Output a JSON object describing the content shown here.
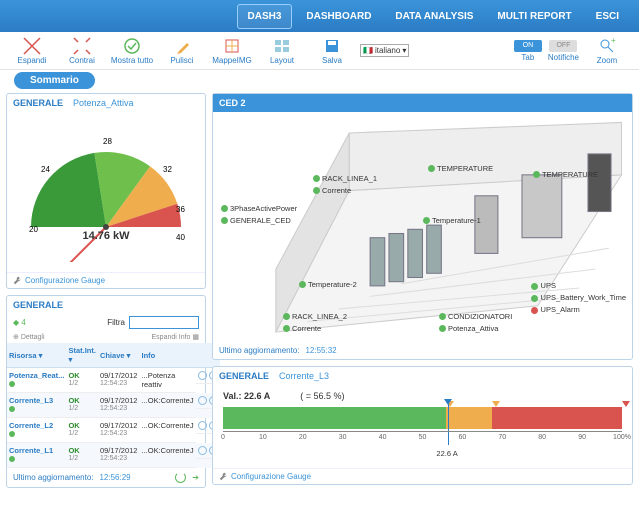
{
  "nav": {
    "items": [
      "DASH3",
      "DASHBOARD",
      "DATA ANALYSIS",
      "MULTI REPORT",
      "ESCI"
    ],
    "active": 0
  },
  "toolbar": {
    "espandi": "Espandi",
    "contrai": "Contrai",
    "mostra": "Mostra tutto",
    "pulisci": "Pulisci",
    "mappe": "MappeIMG",
    "layout": "Layout",
    "salva": "Salva",
    "lang": "italiano",
    "tab": "Tab",
    "notifiche": "Notifiche",
    "zoom": "Zoom",
    "on": "ON",
    "off": "OFF"
  },
  "summary": "Sommario",
  "gauge": {
    "title": "GENERALE",
    "subtitle": "Potenza_Attiva",
    "value": "14.76 kW",
    "ticks": [
      "20",
      "24",
      "28",
      "32",
      "36",
      "40"
    ],
    "config": "Configurazione Gauge"
  },
  "table": {
    "title": "GENERALE",
    "filter_label": "Filtra",
    "dettagli": "Dettagli",
    "espandi": "Espandi Info",
    "cols": [
      "Risorsa",
      "Stat.Int.",
      "Chiave",
      "Info"
    ],
    "rows": [
      {
        "r": "Potenza_Reat...",
        "s": "OK",
        "sv": "1/2",
        "d": "09/17/2012",
        "t": "12:54:23",
        "i": "...Potenza reattiv"
      },
      {
        "r": "Corrente_L3",
        "s": "OK",
        "sv": "1/2",
        "d": "09/17/2012",
        "t": "12:54:23",
        "i": "...OK:CorrenteJ"
      },
      {
        "r": "Corrente_L2",
        "s": "OK",
        "sv": "1/2",
        "d": "09/17/2012",
        "t": "12:54:23",
        "i": "...OK:CorrenteJ"
      },
      {
        "r": "Corrente_L1",
        "s": "OK",
        "sv": "1/2",
        "d": "09/17/2012",
        "t": "12:54:23",
        "i": "...OK:CorrenteJ"
      }
    ],
    "footer_label": "Ultimo aggiornamento:",
    "footer_ts": "12:56:29"
  },
  "ced": {
    "title": "CED 2",
    "markers": {
      "rack1": "RACK_LINEA_1",
      "corrente": "Corrente",
      "phase": "3PhaseActivePower",
      "gen": "GENERALE_CED",
      "temp": "TEMPERATURE",
      "temprt": "TEMPERATURE",
      "temp1": "Temperature-1",
      "temp2": "Temperature-2",
      "rack2": "RACK_LINEA_2",
      "corr2": "Corrente",
      "cond": "CONDIZIONATORI",
      "pot": "Potenza_Attiva",
      "ups": "UPS",
      "upsb": "UPS_Battery_Work_Time",
      "upsa": "UPS_Alarm"
    },
    "footer_label": "Ultimo aggiornamento:",
    "footer_ts": "12:55:32"
  },
  "bar": {
    "title": "GENERALE",
    "subtitle": "Corrente_L3",
    "val_label": "Val.: 22.6 A",
    "pct": "( = 56.5 %)",
    "value_pct": 56.5,
    "yellow_start": 56,
    "yellow_end": 67.5,
    "red_start": 67.5,
    "ticks": [
      "0",
      "10",
      "20",
      "30",
      "40",
      "50",
      "60",
      "70",
      "80",
      "90",
      "100%"
    ],
    "ptr_label": "22.6 A",
    "config": "Configurazione Gauge"
  },
  "chart_data": [
    {
      "type": "gauge",
      "title": "Potenza_Attiva",
      "min": 20,
      "max": 40,
      "value": 14.76,
      "unit": "kW",
      "zones": [
        {
          "from": 20,
          "to": 28,
          "color": "#3a9a3a"
        },
        {
          "from": 28,
          "to": 34,
          "color": "#f0ad4e"
        },
        {
          "from": 34,
          "to": 40,
          "color": "#d9534f"
        }
      ],
      "ticks": [
        20,
        24,
        28,
        32,
        36,
        40
      ]
    },
    {
      "type": "bar",
      "title": "Corrente_L3",
      "value": 22.6,
      "unit": "A",
      "percent": 56.5,
      "ranges": {
        "ok": [
          0,
          56
        ],
        "warn": [
          56,
          67.5
        ],
        "alarm": [
          67.5,
          100
        ]
      },
      "xlim": [
        0,
        100
      ]
    }
  ]
}
